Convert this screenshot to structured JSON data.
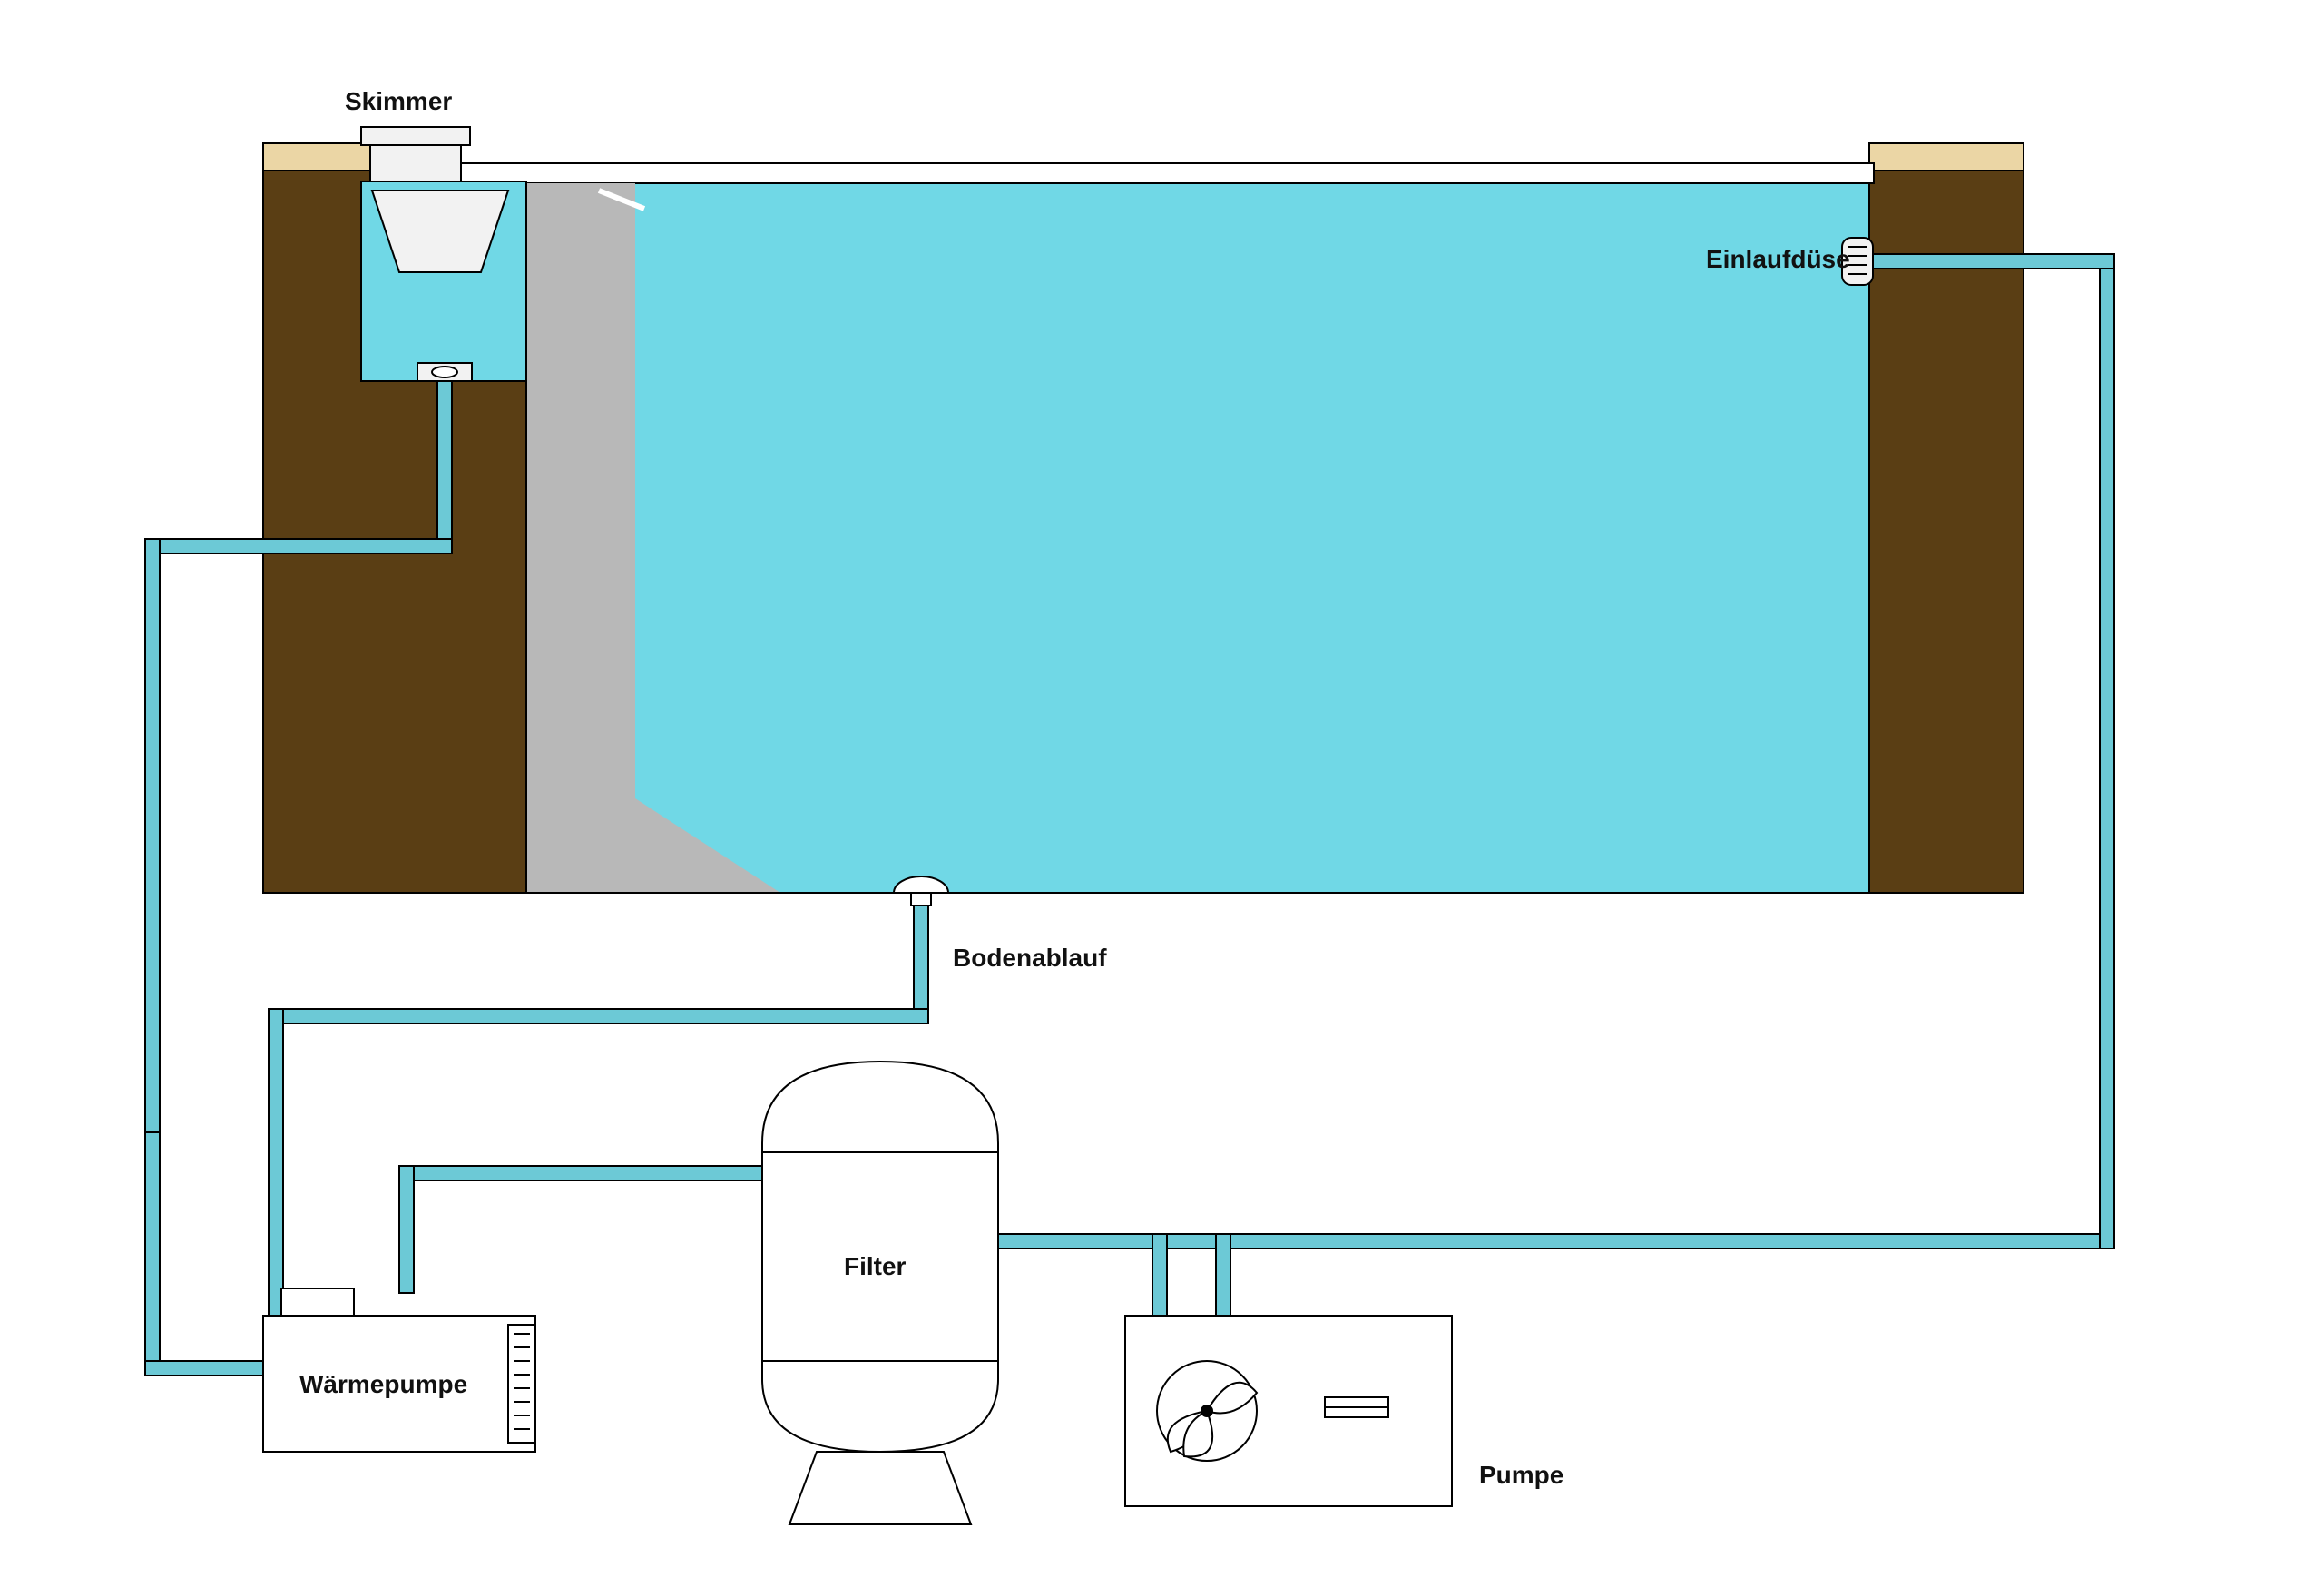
{
  "labels": {
    "skimmer": "Skimmer",
    "inlet": "Einlaufdüse",
    "bottom_drain": "Bodenablauf",
    "filter": "Filter",
    "heat_pump": "Wärmepumpe",
    "pump": "Pumpe"
  },
  "colors": {
    "water": "#70D8E6",
    "pipe": "#6CC9D6",
    "soil": "#5A3E14",
    "sand": "#EBD6A5",
    "grey": "#B8B8B8",
    "outline": "#000000",
    "skimmer_fill": "#F2F2F2",
    "white": "#FFFFFF"
  },
  "diagram": {
    "type": "schematic",
    "subject": "Swimming pool water circulation system",
    "components": [
      {
        "id": "skimmer",
        "label_key": "skimmer",
        "role": "surface water intake"
      },
      {
        "id": "bottom_drain",
        "label_key": "bottom_drain",
        "role": "floor water intake"
      },
      {
        "id": "pump",
        "label_key": "pump",
        "role": "circulation pump"
      },
      {
        "id": "filter",
        "label_key": "filter",
        "role": "sand/cartridge filter"
      },
      {
        "id": "heat_pump",
        "label_key": "heat_pump",
        "role": "water heater"
      },
      {
        "id": "inlet",
        "label_key": "inlet",
        "role": "return jet / Einlaufdüse"
      }
    ],
    "flow_edges": [
      [
        "skimmer",
        "pump"
      ],
      [
        "bottom_drain",
        "pump"
      ],
      [
        "pump",
        "filter"
      ],
      [
        "filter",
        "heat_pump"
      ],
      [
        "heat_pump",
        "inlet"
      ]
    ]
  }
}
